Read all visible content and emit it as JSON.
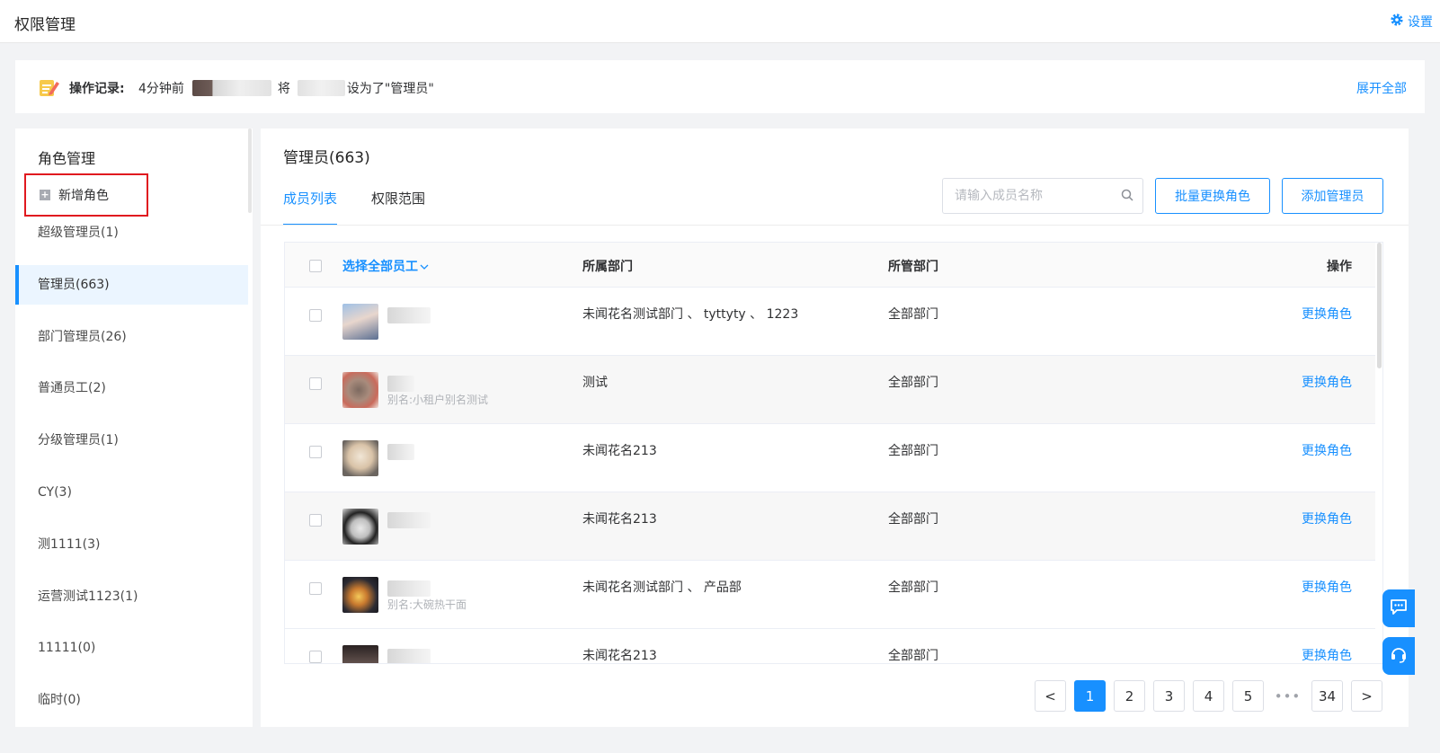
{
  "header": {
    "title": "权限管理",
    "settings_label": "设置"
  },
  "log": {
    "label": "操作记录:",
    "time": "4分钟前",
    "middle": "将",
    "suffix": "设为了\"管理员\"",
    "expand_label": "展开全部"
  },
  "sidebar": {
    "heading": "角色管理",
    "add_role_label": "新增角色",
    "roles": [
      {
        "label": "超级管理员(1)",
        "active": false
      },
      {
        "label": "管理员(663)",
        "active": true
      },
      {
        "label": "部门管理员(26)",
        "active": false
      },
      {
        "label": "普通员工(2)",
        "active": false
      },
      {
        "label": "分级管理员(1)",
        "active": false
      },
      {
        "label": "CY(3)",
        "active": false
      },
      {
        "label": "测1111(3)",
        "active": false
      },
      {
        "label": "运营测试1123(1)",
        "active": false
      },
      {
        "label": "11111(0)",
        "active": false
      },
      {
        "label": "临时(0)",
        "active": false
      }
    ]
  },
  "main": {
    "title": "管理员(663)",
    "tabs": [
      {
        "label": "成员列表",
        "active": true
      },
      {
        "label": "权限范围",
        "active": false
      }
    ],
    "search_placeholder": "请输入成员名称",
    "batch_button": "批量更换角色",
    "add_button": "添加管理员",
    "table": {
      "headers": {
        "select_all": "选择全部员工",
        "dept": "所属部门",
        "managed": "所管部门",
        "op": "操作"
      },
      "rows": [
        {
          "alias": "",
          "dept": "未闻花名测试部门 、 tyttyty 、 1223",
          "managed": "全部部门",
          "op": "更换角色"
        },
        {
          "alias": "别名:小租户别名测试",
          "dept": "测试",
          "managed": "全部部门",
          "op": "更换角色"
        },
        {
          "alias": "",
          "dept": "未闻花名213",
          "managed": "全部部门",
          "op": "更换角色"
        },
        {
          "alias": "",
          "dept": "未闻花名213",
          "managed": "全部部门",
          "op": "更换角色"
        },
        {
          "alias": "别名:大碗热干面",
          "dept": "未闻花名测试部门 、 产品部",
          "managed": "全部部门",
          "op": "更换角色"
        },
        {
          "alias": "",
          "dept": "未闻花名213",
          "managed": "全部部门",
          "op": "更换角色"
        }
      ]
    },
    "pagination": {
      "prev": "<",
      "pages": [
        "1",
        "2",
        "3",
        "4",
        "5"
      ],
      "ellipsis": "•••",
      "last": "34",
      "next": ">",
      "current": "1"
    }
  },
  "colors": {
    "accent": "#1890ff",
    "highlight_border": "#e0191f"
  }
}
